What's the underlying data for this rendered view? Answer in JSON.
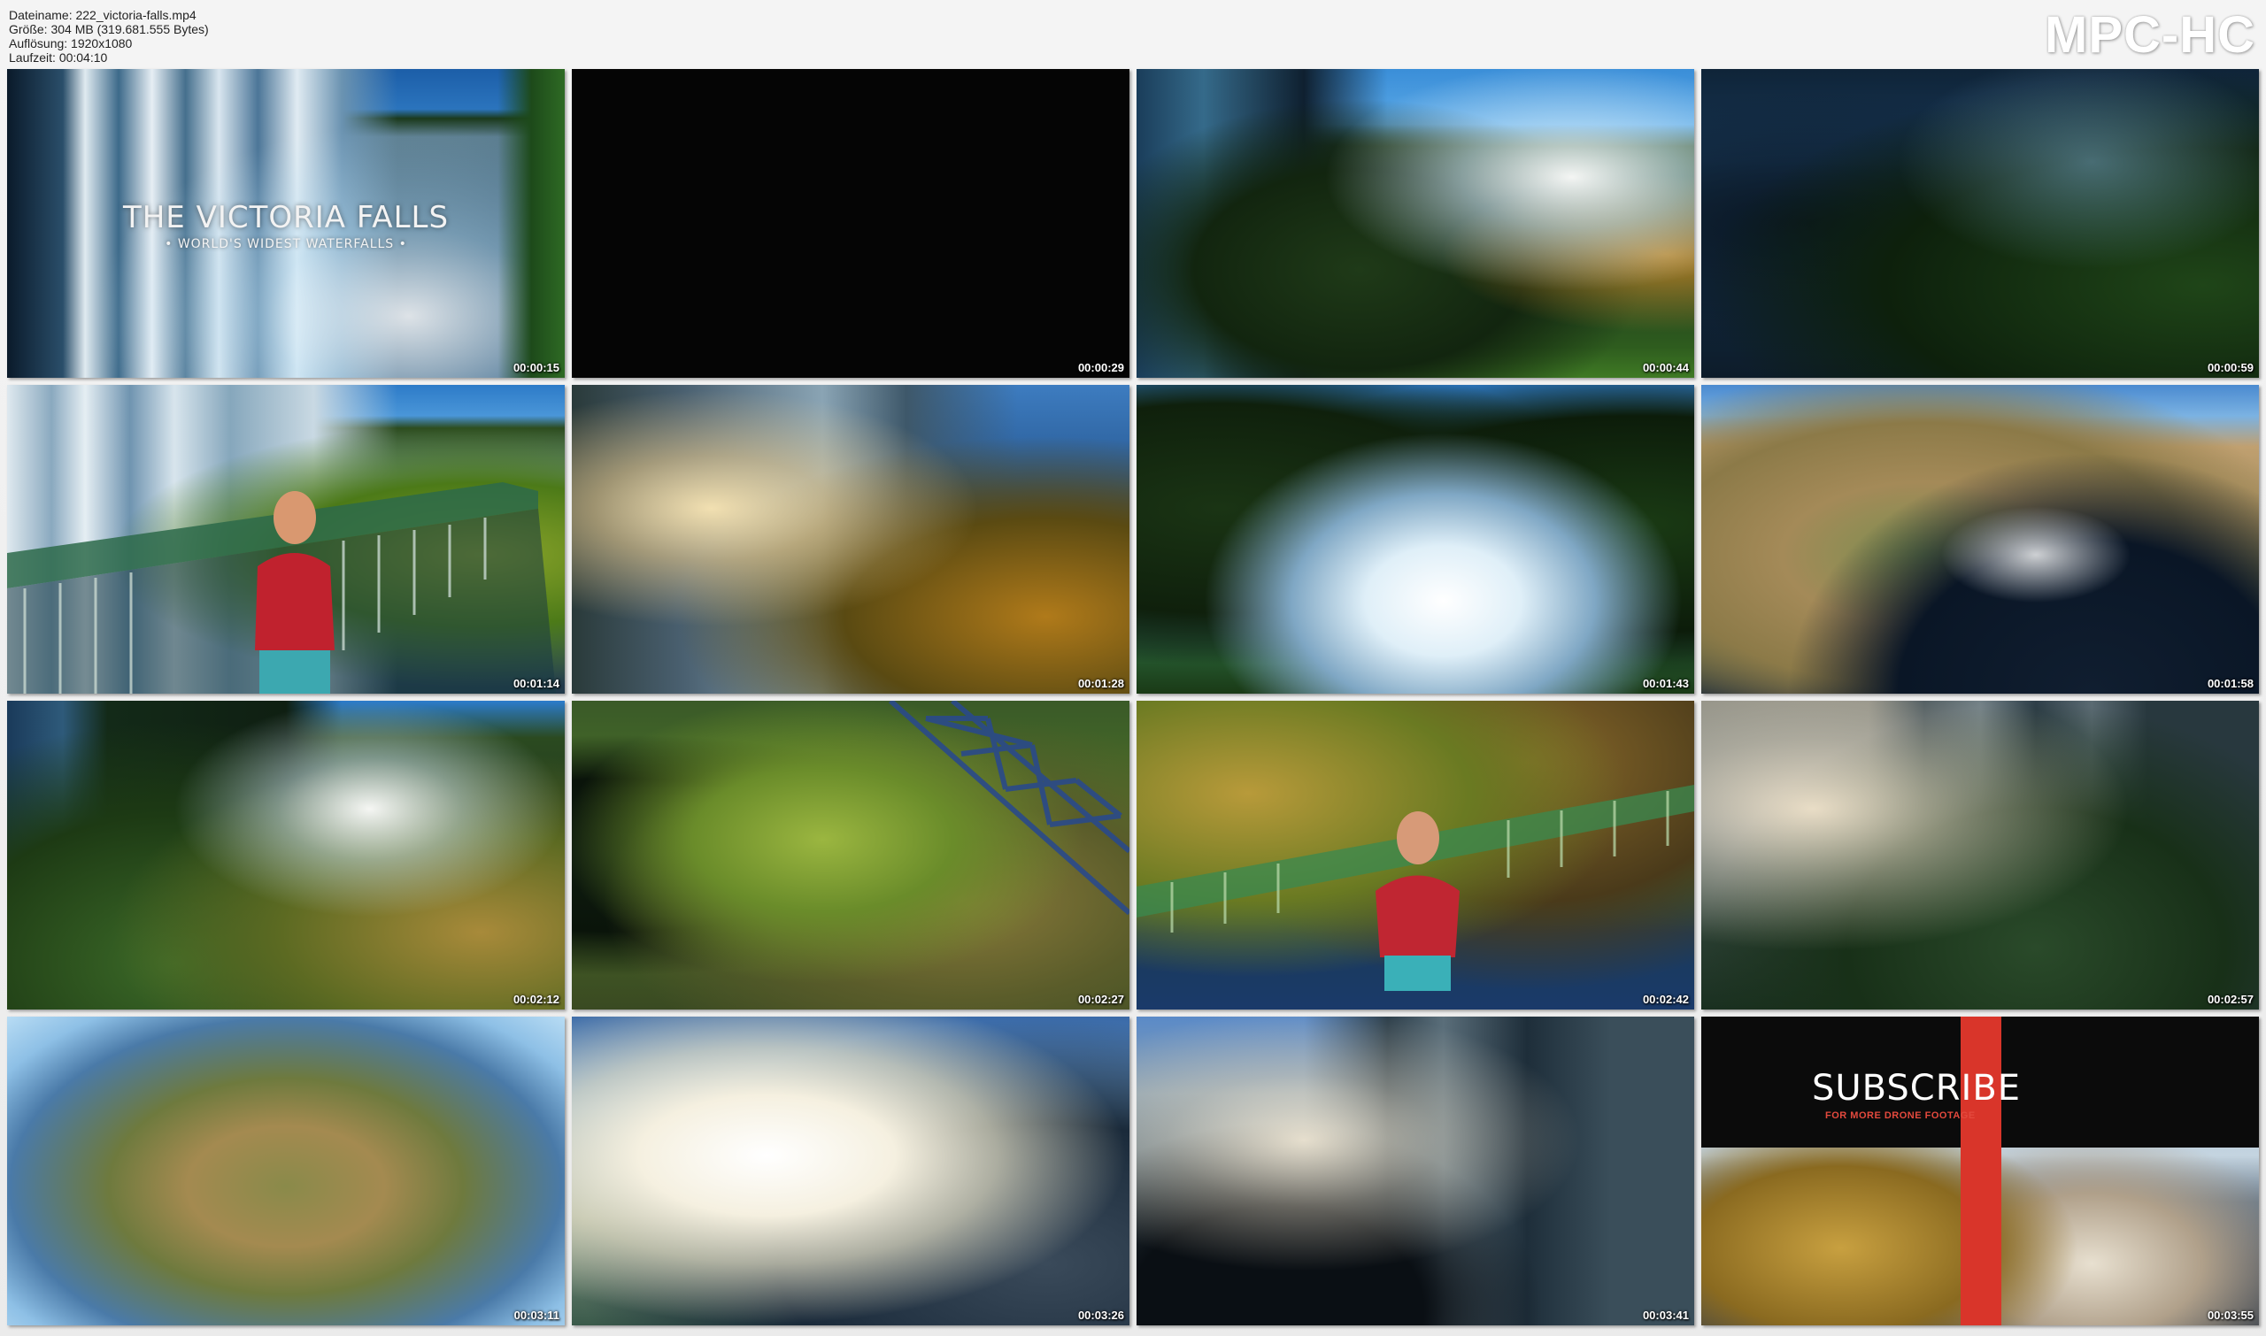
{
  "file_info": {
    "filename": "Dateiname: 222_victoria-falls.mp4",
    "size": "Größe: 304 MB (319.681.555 Bytes)",
    "resolution": "Auflösung: 1920x1080",
    "duration": "Laufzeit: 00:04:10"
  },
  "brand": "MPC-HC",
  "thumbnails": [
    {
      "timestamp": "00:00:15",
      "overlay_title": "THE VICTORIA FALLS",
      "overlay_subtitle": "• WORLD'S WIDEST WATERFALLS •"
    },
    {
      "timestamp": "00:00:29"
    },
    {
      "timestamp": "00:00:44"
    },
    {
      "timestamp": "00:00:59"
    },
    {
      "timestamp": "00:01:14"
    },
    {
      "timestamp": "00:01:28"
    },
    {
      "timestamp": "00:01:43"
    },
    {
      "timestamp": "00:01:58"
    },
    {
      "timestamp": "00:02:12"
    },
    {
      "timestamp": "00:02:27"
    },
    {
      "timestamp": "00:02:42"
    },
    {
      "timestamp": "00:02:57"
    },
    {
      "timestamp": "00:03:11"
    },
    {
      "timestamp": "00:03:26"
    },
    {
      "timestamp": "00:03:41"
    },
    {
      "timestamp": "00:03:55",
      "subscribe_title": "SUBSCRIBE",
      "subscribe_subtitle": "FOR MORE DRONE FOOTAGE"
    }
  ]
}
